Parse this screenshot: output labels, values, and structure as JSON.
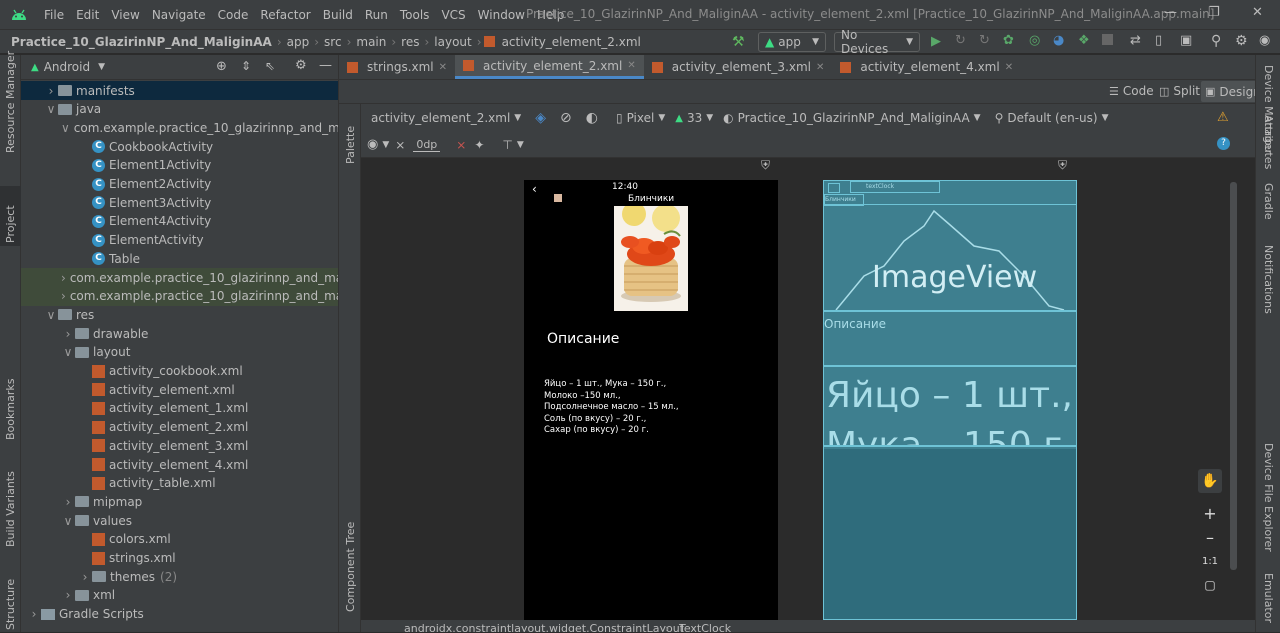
{
  "menu": [
    "File",
    "Edit",
    "View",
    "Navigate",
    "Code",
    "Refactor",
    "Build",
    "Run",
    "Tools",
    "VCS",
    "Window",
    "Help"
  ],
  "window_title": "Practice_10_GlazirinNP_And_MaliginAA - activity_element_2.xml [Practice_10_GlazirinNP_And_MaliginAA.app.main]",
  "breadcrumbs": [
    "Practice_10_GlazirinNP_And_MaliginAA",
    "app",
    "src",
    "main",
    "res",
    "layout",
    "activity_element_2.xml"
  ],
  "toolbar": {
    "config": "app",
    "devices": "No Devices"
  },
  "project_panel": {
    "view": "Android"
  },
  "tree": [
    {
      "label": "manifests",
      "type": "folder",
      "indent": 1,
      "arrow": ">",
      "state": "sel"
    },
    {
      "label": "java",
      "type": "folder",
      "indent": 1,
      "arrow": "v"
    },
    {
      "label": "com.example.practice_10_glazirinnp_and_maligin",
      "type": "package",
      "indent": 2,
      "arrow": "v"
    },
    {
      "label": "CookbookActivity",
      "type": "class",
      "indent": 3
    },
    {
      "label": "Element1Activity",
      "type": "class",
      "indent": 3
    },
    {
      "label": "Element2Activity",
      "type": "class",
      "indent": 3
    },
    {
      "label": "Element3Activity",
      "type": "class",
      "indent": 3
    },
    {
      "label": "Element4Activity",
      "type": "class",
      "indent": 3
    },
    {
      "label": "ElementActivity",
      "type": "class",
      "indent": 3
    },
    {
      "label": "Table",
      "type": "class",
      "indent": 3
    },
    {
      "label": "com.example.practice_10_glazirinnp_and_maligin",
      "type": "package",
      "indent": 2,
      "arrow": ">",
      "state": "grn"
    },
    {
      "label": "com.example.practice_10_glazirinnp_and_maligin",
      "type": "package",
      "indent": 2,
      "arrow": ">",
      "state": "grn"
    },
    {
      "label": "res",
      "type": "folder",
      "indent": 1,
      "arrow": "v"
    },
    {
      "label": "drawable",
      "type": "folder",
      "indent": 2,
      "arrow": ">"
    },
    {
      "label": "layout",
      "type": "folder",
      "indent": 2,
      "arrow": "v"
    },
    {
      "label": "activity_cookbook.xml",
      "type": "xml",
      "indent": 3
    },
    {
      "label": "activity_element.xml",
      "type": "xml",
      "indent": 3
    },
    {
      "label": "activity_element_1.xml",
      "type": "xml",
      "indent": 3
    },
    {
      "label": "activity_element_2.xml",
      "type": "xml",
      "indent": 3
    },
    {
      "label": "activity_element_3.xml",
      "type": "xml",
      "indent": 3
    },
    {
      "label": "activity_element_4.xml",
      "type": "xml",
      "indent": 3
    },
    {
      "label": "activity_table.xml",
      "type": "xml",
      "indent": 3
    },
    {
      "label": "mipmap",
      "type": "folder",
      "indent": 2,
      "arrow": ">"
    },
    {
      "label": "values",
      "type": "folder",
      "indent": 2,
      "arrow": "v"
    },
    {
      "label": "colors.xml",
      "type": "xml",
      "indent": 3
    },
    {
      "label": "strings.xml",
      "type": "xml",
      "indent": 3
    },
    {
      "label": "themes",
      "type": "folder",
      "indent": 3,
      "arrow": ">",
      "count": "(2)"
    },
    {
      "label": "xml",
      "type": "folder",
      "indent": 2,
      "arrow": ">"
    },
    {
      "label": "Gradle Scripts",
      "type": "gradle",
      "indent": 0,
      "arrow": ">"
    }
  ],
  "left_strip": [
    "Resource Manager",
    "Project",
    "Bookmarks",
    "Build Variants",
    "Structure"
  ],
  "right_strip": [
    "Device Manager",
    "Attributes",
    "Gradle",
    "Notifications",
    "Device File Explorer",
    "Emulator"
  ],
  "editor_tabs": [
    {
      "label": "strings.xml",
      "active": false
    },
    {
      "label": "activity_element_2.xml",
      "active": true
    },
    {
      "label": "activity_element_3.xml",
      "active": false
    },
    {
      "label": "activity_element_4.xml",
      "active": false
    }
  ],
  "view_modes": [
    "Code",
    "Split",
    "Design"
  ],
  "design_toolbar": {
    "file": "activity_element_2.xml",
    "device": "Pixel",
    "api": "33",
    "theme": "Practice_10_GlazirinNP_And_MaliginAA",
    "locale": "Default (en-us)",
    "dp": "0dp"
  },
  "palette_label": "Palette",
  "component_tree_label": "Component Tree",
  "phone": {
    "time": "12:40",
    "title": "Блинчики",
    "description_label": "Описание",
    "recipe_lines": [
      "Яйцо – 1 шт., Мука – 150 г.,",
      "Молоко –150 мл.,",
      "Подсолнечное масло – 15 мл.,",
      "Соль (по вкусу) – 20 г.,",
      "Сахар (по вкусу) – 20 г."
    ]
  },
  "blueprint": {
    "textclock": "textClock",
    "title_small": "Блинчики",
    "imageview": "ImageView",
    "description": "Описание",
    "big_text_1": "Яйцо – 1 шт.,",
    "big_text_2": "Мука – 150 г."
  },
  "zoom": {
    "fit": "1:1"
  },
  "status_path": [
    "androidx.constraintlayout.widget.ConstraintLayout",
    "TextClock"
  ],
  "colors": {
    "accent": "#4a88c7",
    "blueprint": "#3e7f8f",
    "blueprint_line": "#6ec3d6"
  }
}
